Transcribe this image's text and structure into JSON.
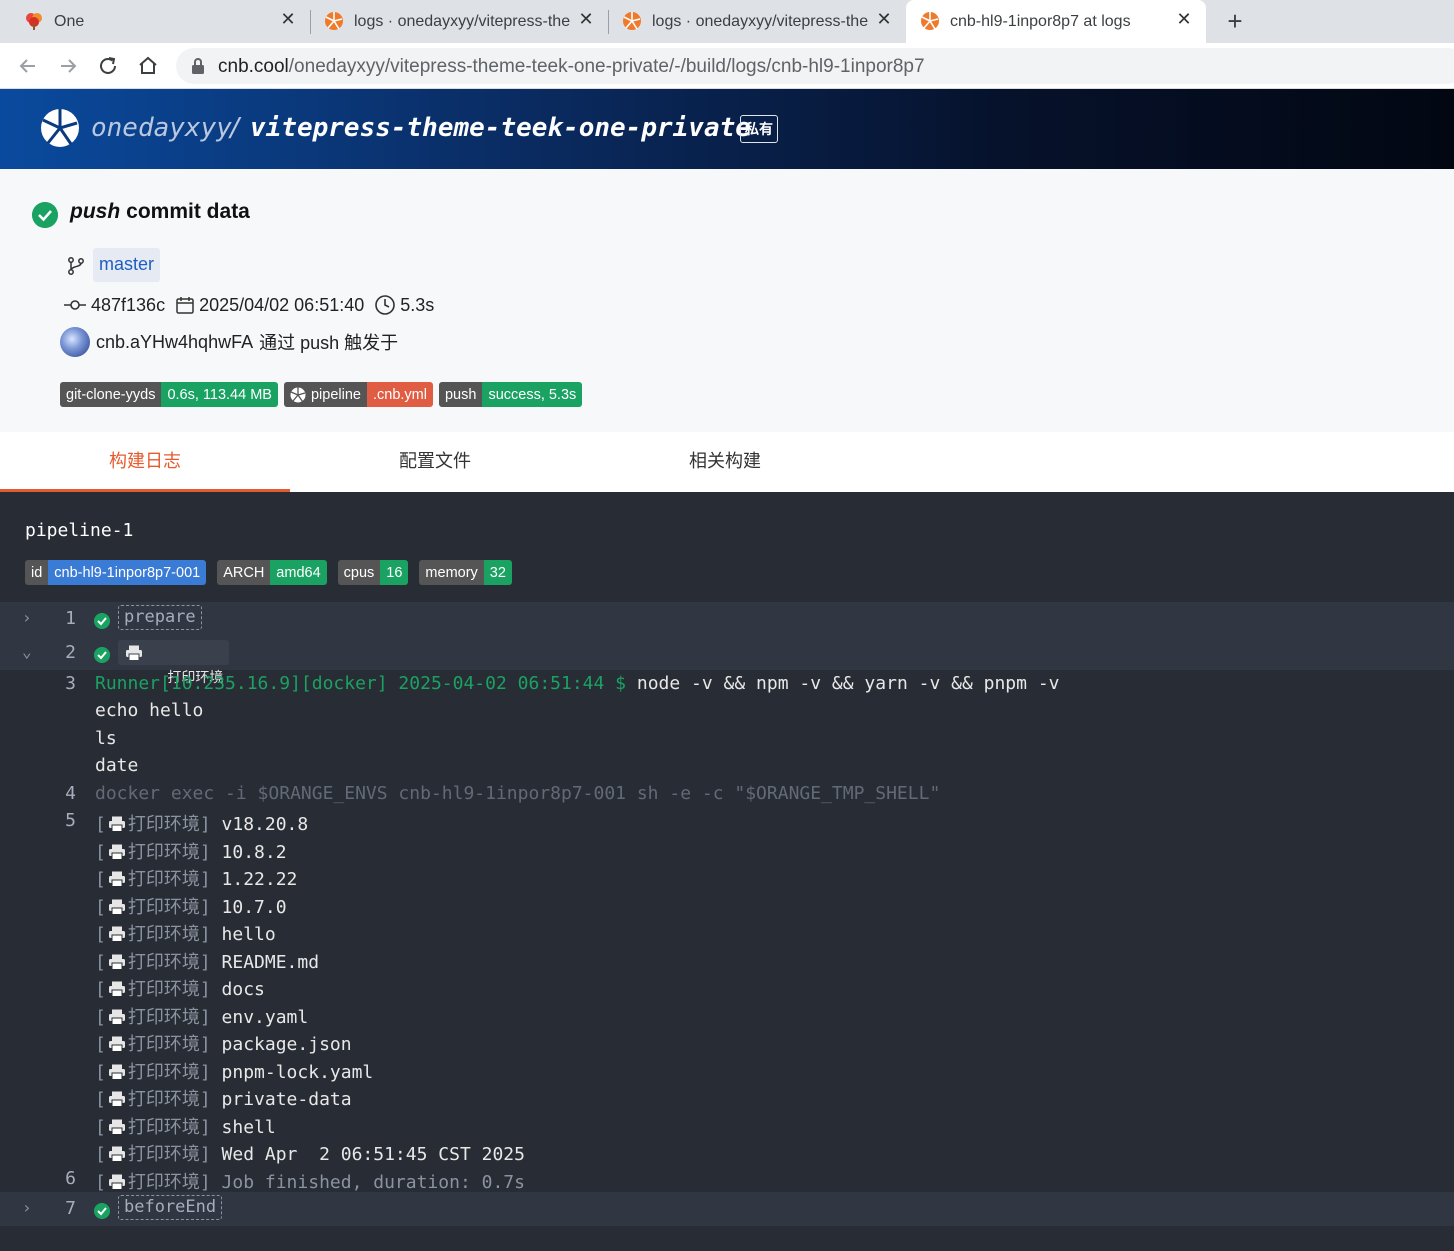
{
  "browser": {
    "tabs": [
      {
        "title": "One",
        "active": false
      },
      {
        "title": "logs · onedayxyy/vitepress-the",
        "active": false
      },
      {
        "title": "logs · onedayxyy/vitepress-the",
        "active": false
      },
      {
        "title": "cnb-hl9-1inpor8p7 at logs",
        "active": true
      }
    ],
    "close_glyph": "✕",
    "new_tab_glyph": "+",
    "url_host": "cnb.cool",
    "url_path": "/onedayxyy/vitepress-theme-teek-one-private/-/build/logs/cnb-hl9-1inpor8p7"
  },
  "repo": {
    "owner": "onedayxyy",
    "separator": "/",
    "name": "vitepress-theme-teek-one-private",
    "visibility": "私有"
  },
  "build": {
    "event": "push",
    "title": "commit data",
    "branch": "master",
    "commit": "487f136c",
    "date": "2025/04/02 06:51:40",
    "duration": "5.3s",
    "trigger_user": "cnb.aYHw4hqhwFA",
    "trigger_text": "通过 push 触发于",
    "badges": [
      {
        "label": "git-clone-yyds",
        "value": "0.6s, 113.44 MB",
        "color": "#1aa263"
      },
      {
        "label": "pipeline",
        "value": ".cnb.yml",
        "color": "#e05d44"
      },
      {
        "label": "push",
        "value": "success, 5.3s",
        "color": "#1aa263"
      }
    ]
  },
  "tabs": [
    "构建日志",
    "配置文件",
    "相关构建"
  ],
  "pipeline": {
    "name": "pipeline-1",
    "badges": [
      {
        "label": "id",
        "value": "cnb-hl9-1inpor8p7-001"
      },
      {
        "label": "ARCH",
        "value": "amd64"
      },
      {
        "label": "cpus",
        "value": "16"
      },
      {
        "label": "memory",
        "value": "32"
      }
    ]
  },
  "log": {
    "step1": {
      "num": "1",
      "name": "prepare",
      "chevron": "›"
    },
    "step2": {
      "num": "2",
      "name": "打印环境",
      "chevron": "⌄"
    },
    "line3": {
      "num": "3",
      "prompt": "Runner[10.235.16.9][docker] 2025-04-02 06:51:44 $",
      "cmd": " node -v && npm -v && yarn -v && pnpm -v",
      "cont": [
        "echo hello",
        "ls",
        "date"
      ]
    },
    "line4": {
      "num": "4",
      "text": "docker exec -i $ORANGE_ENVS cnb-hl9-1inpor8p7-001 sh -e -c \"$ORANGE_TMP_SHELL\""
    },
    "line5": {
      "num": "5"
    },
    "output_prefix": "打印环境",
    "outputs": [
      "v18.20.8",
      "10.8.2",
      "1.22.22",
      "10.7.0",
      "hello",
      "README.md",
      "docs",
      "env.yaml",
      "package.json",
      "pnpm-lock.yaml",
      "private-data",
      "shell",
      "Wed Apr  2 06:51:45 CST 2025"
    ],
    "line6": {
      "num": "6",
      "text": "Job finished, duration: 0.7s"
    },
    "step7": {
      "num": "7",
      "name": "beforeEnd",
      "chevron": "›"
    }
  }
}
